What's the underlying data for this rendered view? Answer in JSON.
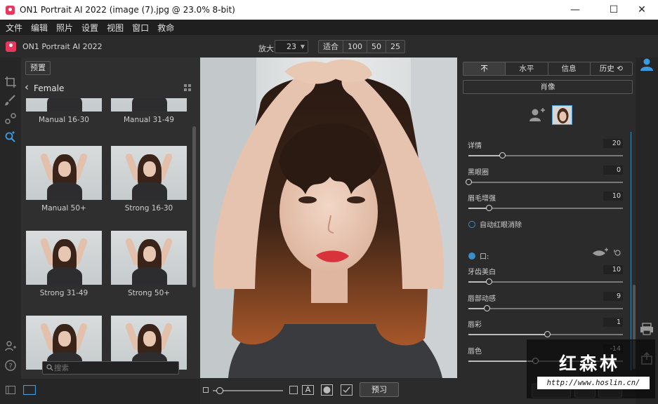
{
  "window": {
    "title": "ON1 Portrait AI 2022 (image (7).jpg @ 23.0% 8-bit)",
    "minimize": "—",
    "maximize": "☐",
    "close": "✕"
  },
  "menu": [
    "文件",
    "编辑",
    "照片",
    "设置",
    "视图",
    "窗口",
    "救命"
  ],
  "header": {
    "app_name": "ON1 Portrait AI 2022",
    "zoom_label": "放大",
    "zoom_value": "23",
    "zoom_options": [
      "适合",
      "100",
      "50",
      "25"
    ]
  },
  "browser": {
    "preset_button": "预置",
    "category": "Female",
    "thumbnails": [
      {
        "label": "Manual 16-30"
      },
      {
        "label": "Manual 31-49"
      },
      {
        "label": "Manual 50+"
      },
      {
        "label": "Strong 16-30"
      },
      {
        "label": "Strong 31-49"
      },
      {
        "label": "Strong 50+"
      },
      {
        "label": ""
      },
      {
        "label": ""
      }
    ],
    "search_placeholder": "搜索"
  },
  "right": {
    "tabs": [
      "不",
      "水平",
      "信息",
      "历史 ⟲"
    ],
    "active_tab": 0,
    "portrait_button": "肖像",
    "sliders_top": [
      {
        "label": "详情",
        "value": "20",
        "fraction": 0.22
      },
      {
        "label": "黑眼圈",
        "value": "0",
        "fraction": 0.0
      },
      {
        "label": "眉毛增强",
        "value": "10",
        "fraction": 0.13
      }
    ],
    "redeye_label": "自动红眼消除",
    "mouth_label": "口:",
    "sliders_mouth": [
      {
        "label": "牙齿美白",
        "value": "10",
        "fraction": 0.13
      },
      {
        "label": "唇部动感",
        "value": "9",
        "fraction": 0.12
      },
      {
        "label": "唇彩",
        "value": "1",
        "fraction": 0.51
      },
      {
        "label": "唇色",
        "value": "-14",
        "fraction": 0.43
      }
    ]
  },
  "bottom": {
    "preview_button": "预习",
    "text_tool": "A"
  },
  "watermark": {
    "cn": "红森林",
    "url": "http://www.hoslin.cn/"
  }
}
